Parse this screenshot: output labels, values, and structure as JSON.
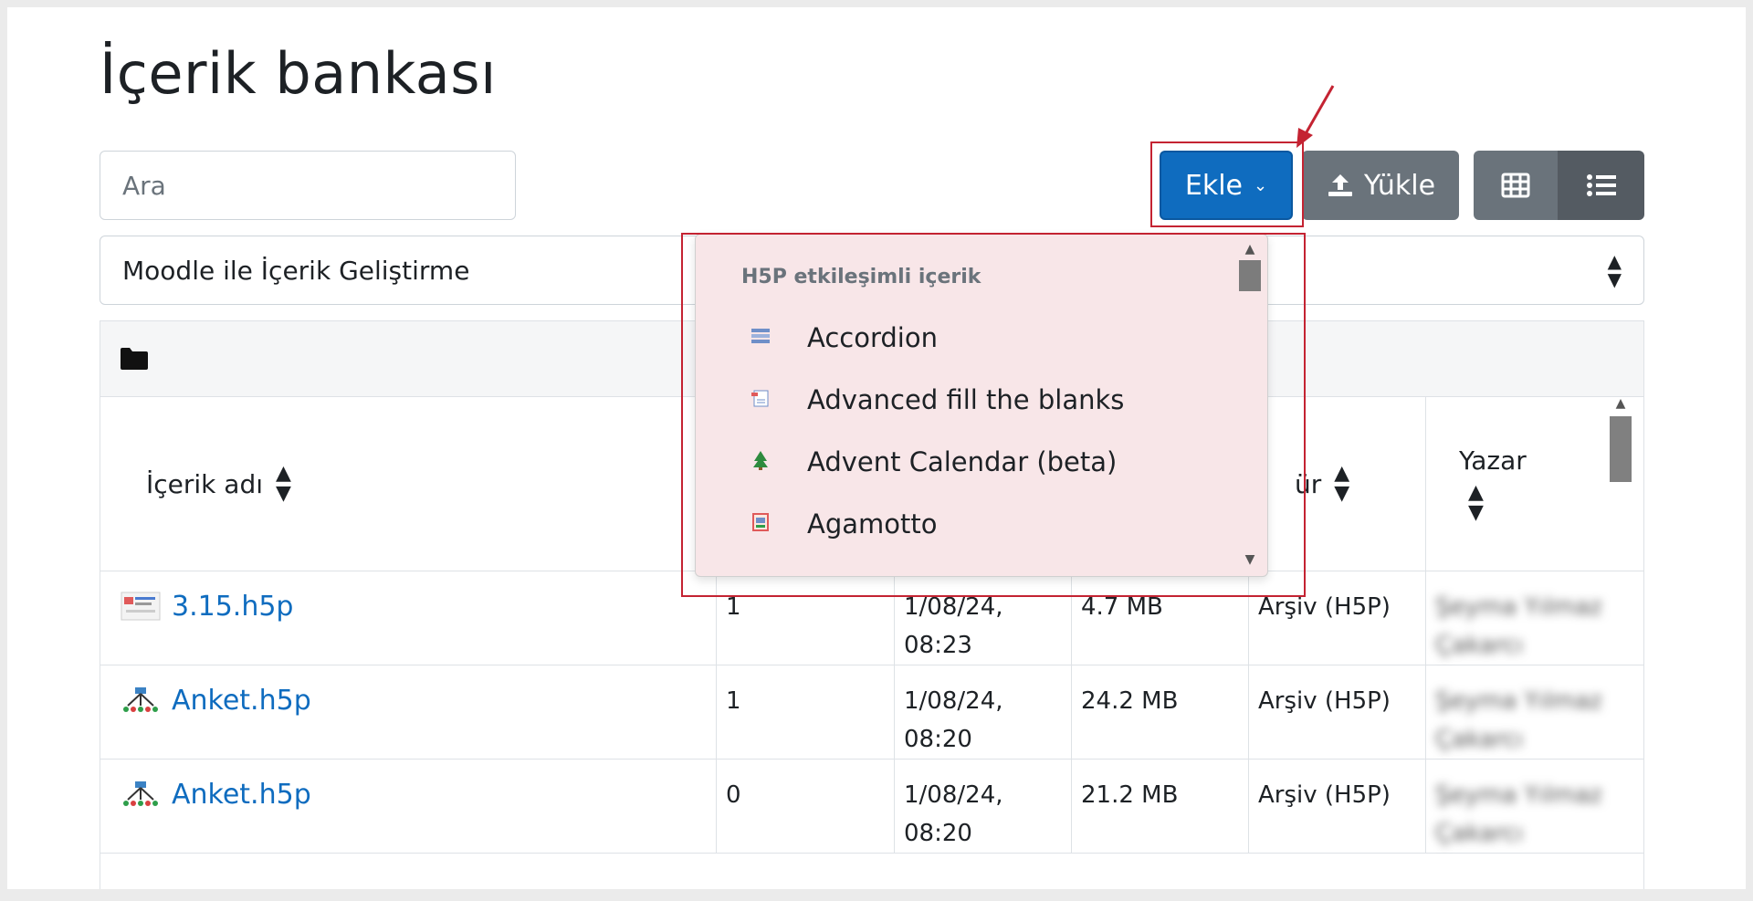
{
  "page": {
    "title": "İçerik bankası"
  },
  "search": {
    "placeholder": "Ara"
  },
  "context": {
    "selected": "Moodle ile İçerik Geliştirme"
  },
  "toolbar": {
    "add_label": "Ekle",
    "upload_label": "Yükle",
    "grid_view_icon": "grid-icon",
    "list_view_icon": "list-icon"
  },
  "dropdown": {
    "header": "H5P etkileşimli içerik",
    "items": [
      {
        "label": "Accordion",
        "icon": "accordion-icon"
      },
      {
        "label": "Advanced fill the blanks",
        "icon": "fill-blanks-icon"
      },
      {
        "label": "Advent Calendar (beta)",
        "icon": "tree-icon"
      },
      {
        "label": "Agamotto",
        "icon": "agamotto-icon"
      }
    ]
  },
  "table": {
    "columns": {
      "name": "İçerik adı",
      "type_partial": "ür",
      "author": "Yazar"
    },
    "rows": [
      {
        "name": "3.15.h5p",
        "uses": "1",
        "date": "1/08/24,",
        "time": "08:23",
        "size": "4.7 MB",
        "type": "Arşiv (H5P)",
        "author": "Şeyma Yılmaz Çakarcı"
      },
      {
        "name": "Anket.h5p",
        "uses": "1",
        "date": "1/08/24,",
        "time": "08:20",
        "size": "24.2 MB",
        "type": "Arşiv (H5P)",
        "author": "Şeyma Yılmaz Çakarcı"
      },
      {
        "name": "Anket.h5p",
        "uses": "0",
        "date": "1/08/24,",
        "time": "08:20",
        "size": "21.2 MB",
        "type": "Arşiv (H5P)",
        "author": "Şeyma Yılmaz Çakarcı"
      }
    ]
  },
  "colors": {
    "primary": "#0f6cbf",
    "secondary": "#6a737b",
    "highlight": "#c42332"
  }
}
